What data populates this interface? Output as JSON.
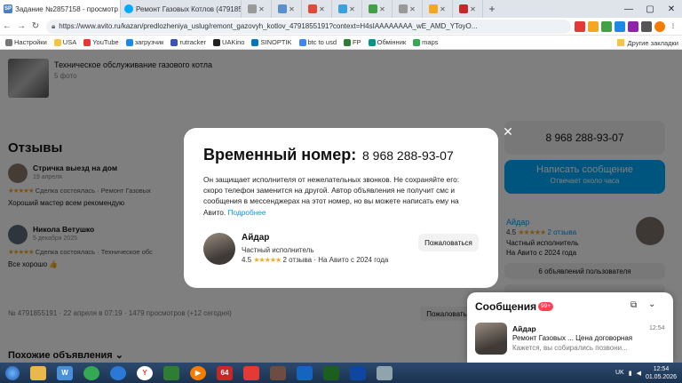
{
  "browser": {
    "tabs": [
      {
        "title": "Задание №2857158 - просмотр з",
        "icon": "sp-icon",
        "color": "#4a7fc1",
        "glyph": "SP"
      },
      {
        "title": "Ремонт Газовых Котлов (4791855",
        "icon": "avito-icon",
        "color": "#00aaff",
        "glyph": ""
      },
      {
        "title": "",
        "icon": "page-icon",
        "color": "#999999",
        "glyph": ""
      }
    ],
    "url": "https://www.avito.ru/kazan/predlozheniya_uslug/remont_gazovyh_kotlov_4791855191?context=H4sIAAAAAAAA_wE_AMD_YToyO...",
    "bookmarks": [
      "Настройки",
      "USA",
      "YouTube",
      "загрузчик",
      "rutracker",
      "UAKino",
      "SINOPTIK",
      "btc to usd",
      "FP",
      "Обмінник",
      "maps"
    ],
    "bookmarks_right": "Другие закладки"
  },
  "page": {
    "service_title": "Техническое обслуживание газового котла",
    "photo_count": "5 фото",
    "reviews_heading": "Отзывы",
    "reviews": [
      {
        "name": "Стричка выезд на дом",
        "date": "19 апреля",
        "stars": "★★★★★",
        "deal": "Сделка состоялась · Ремонт Газовых",
        "text": "Хороший мастер всем рекомендую"
      },
      {
        "name": "Никола Ветушко",
        "date": "5 декабря 2025",
        "stars": "★★★★★",
        "deal": "Сделка состоялась · Техническое обс",
        "text": "Все хорошо 👍"
      }
    ],
    "meta": "№ 4791855191 · 22 апреля в 07:19 · 1479 просмотров (+12 сегодня)",
    "complain_bg": "Пожаловать",
    "similar": "Похожие объявления ⌄",
    "phone": "8 968 288-93-07",
    "message_btn": "Написать сообщение",
    "message_sub": "Отвечает около часа",
    "seller": {
      "name": "Айдар",
      "rating": "4.5",
      "stars": "★★★★★",
      "reviews": "2 отзыва",
      "type": "Частный исполнитель",
      "since": "На Авито с 2024 года"
    },
    "ads_btn": "6 объявлений пользователя"
  },
  "modal": {
    "title": "Временный номер:",
    "number": "8 968 288-93-07",
    "text": "Он защищает исполнителя от нежелательных звонков. Не сохраняйте его: скоро телефон заменится на другой. Автор объявления не получит смс и сообщения в мессенджерах на этот номер, но вы можете написать ему на Авито.",
    "link": "Подробнее",
    "seller_name": "Айдар",
    "seller_type": "Частный исполнитель",
    "rating": "4.5",
    "stars": "★★★★★",
    "reviews": "2 отзыва",
    "since": "· На Авито с 2024 года",
    "complain": "Пожаловаться",
    "close": "✕"
  },
  "messenger": {
    "title": "Сообщения",
    "badge": "99+",
    "name": "Айдар",
    "time": "12:54",
    "subject": "Ремонт Газовых ... Цена договорная",
    "preview": "Кажется, вы собирались позвони..."
  },
  "taskbar": {
    "lang": "UK",
    "time": "12:54",
    "date": "01.05.2026"
  }
}
